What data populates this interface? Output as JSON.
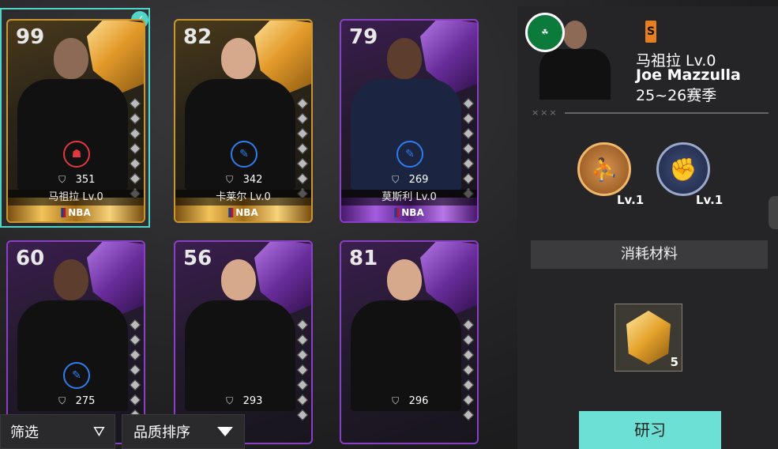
{
  "cards": [
    {
      "rating": "99",
      "power": "351",
      "name": "马祖拉 Lv.0",
      "tier": "gold",
      "role": "red",
      "selected": true
    },
    {
      "rating": "82",
      "power": "342",
      "name": "卡莱尔 Lv.0",
      "tier": "gold",
      "role": "blue",
      "selected": false
    },
    {
      "rating": "79",
      "power": "269",
      "name": "莫斯利 Lv.0",
      "tier": "purple",
      "role": "blue",
      "selected": false
    },
    {
      "rating": "60",
      "power": "275",
      "name": "",
      "tier": "purple",
      "role": "blue",
      "selected": false
    },
    {
      "rating": "56",
      "power": "293",
      "name": "",
      "tier": "purple",
      "role": "none",
      "selected": false
    },
    {
      "rating": "81",
      "power": "296",
      "name": "",
      "tier": "purple",
      "role": "none",
      "selected": false
    }
  ],
  "league_logo_text": "NBA",
  "bottom_bar": {
    "filter_label": "筛选",
    "sort_label": "品质排序"
  },
  "detail": {
    "rank_badge": "S",
    "name_cn": "马祖拉  Lv.0",
    "name_en": "Joe Mazzulla",
    "season": "25~26赛季",
    "divider_marks": "×××",
    "skills": [
      {
        "icon": "basketball-defense-icon",
        "level": "Lv.1"
      },
      {
        "icon": "raised-fist-icon",
        "level": "Lv.1"
      }
    ],
    "consume_label": "消耗材料",
    "material_count": "5",
    "research_label": "研习"
  },
  "colors": {
    "accent": "#4fd6c8",
    "gold": "#c9962f",
    "purple": "#8a3fc7",
    "research_button": "#6de0d6"
  }
}
